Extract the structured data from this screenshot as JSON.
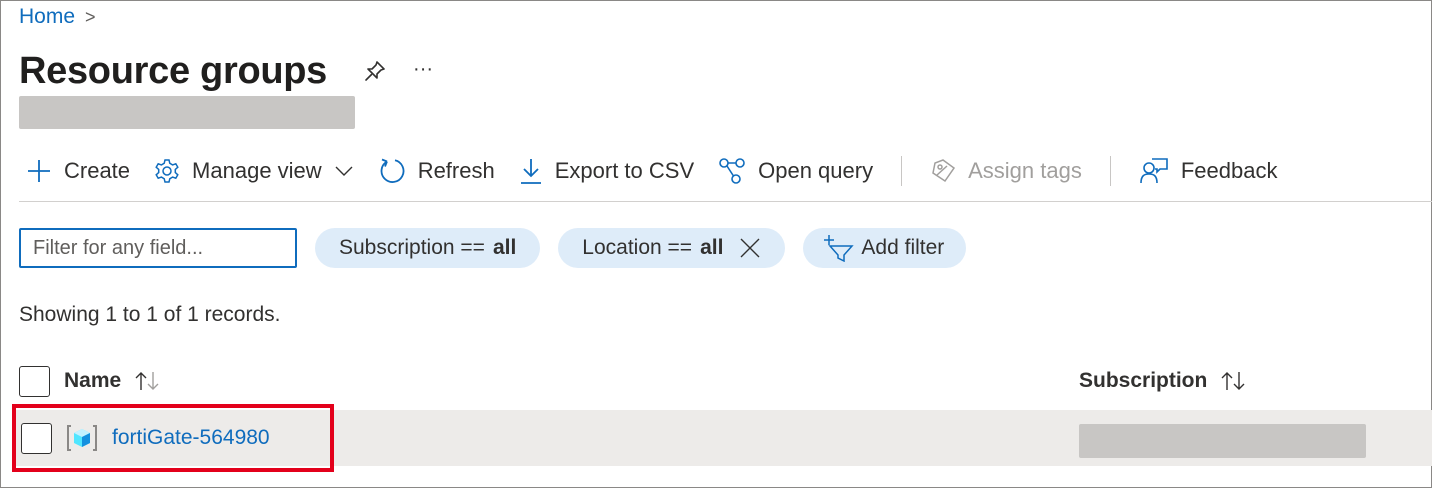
{
  "breadcrumb": {
    "home": "Home",
    "separator": ">"
  },
  "header": {
    "title": "Resource groups",
    "more": "···",
    "pin_icon": "pin-icon"
  },
  "toolbar": {
    "create": "Create",
    "manage_view": "Manage view",
    "refresh": "Refresh",
    "export_csv": "Export to CSV",
    "open_query": "Open query",
    "assign_tags": "Assign tags",
    "feedback": "Feedback"
  },
  "filters": {
    "placeholder": "Filter for any field...",
    "subscription_label": "Subscription ==",
    "subscription_value": "all",
    "location_label": "Location ==",
    "location_value": "all",
    "add_filter": "Add filter"
  },
  "records_text": "Showing 1 to 1 of 1 records.",
  "table": {
    "columns": {
      "name": "Name",
      "subscription": "Subscription"
    },
    "rows": [
      {
        "name": "fortiGate-564980",
        "subscription": ""
      }
    ]
  },
  "colors": {
    "accent": "#0f6cbd",
    "pill_bg": "#deecf9",
    "row_bg": "#edebe9",
    "highlight": "#e3001b"
  }
}
